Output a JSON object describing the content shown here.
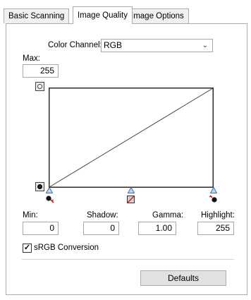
{
  "tabs": [
    {
      "label": "Basic Scanning",
      "active": false
    },
    {
      "label": "Image Quality",
      "active": true
    },
    {
      "label": "Image Options",
      "active": false
    }
  ],
  "color_channel": {
    "label": "Color Channel:",
    "value": "RGB"
  },
  "max": {
    "label": "Max:",
    "value": "255"
  },
  "curve": {
    "line_color": "#4a4a4a",
    "frame_color": "#2b2b2b"
  },
  "fields": {
    "min": {
      "label": "Min:",
      "value": "0"
    },
    "shadow": {
      "label": "Shadow:",
      "value": "0"
    },
    "gamma": {
      "label": "Gamma:",
      "value": "1.00"
    },
    "highlight": {
      "label": "Highlight:",
      "value": "255"
    }
  },
  "srgb": {
    "label": "sRGB Conversion",
    "checked": true
  },
  "defaults_button": "Defaults",
  "icons": {
    "white_point": "white-point-square-icon",
    "black_point": "black-point-square-icon",
    "slider_marker": "triangle-marker-icon",
    "black_eyedropper": "black-eyedropper-icon",
    "gray_eyedropper": "gray-eyedropper-icon",
    "white_eyedropper": "white-eyedropper-icon"
  },
  "colors": {
    "marker_fill": "#bcd7f0",
    "marker_stroke": "#3c6fa8",
    "eyedropper_accent": "#d42020"
  }
}
